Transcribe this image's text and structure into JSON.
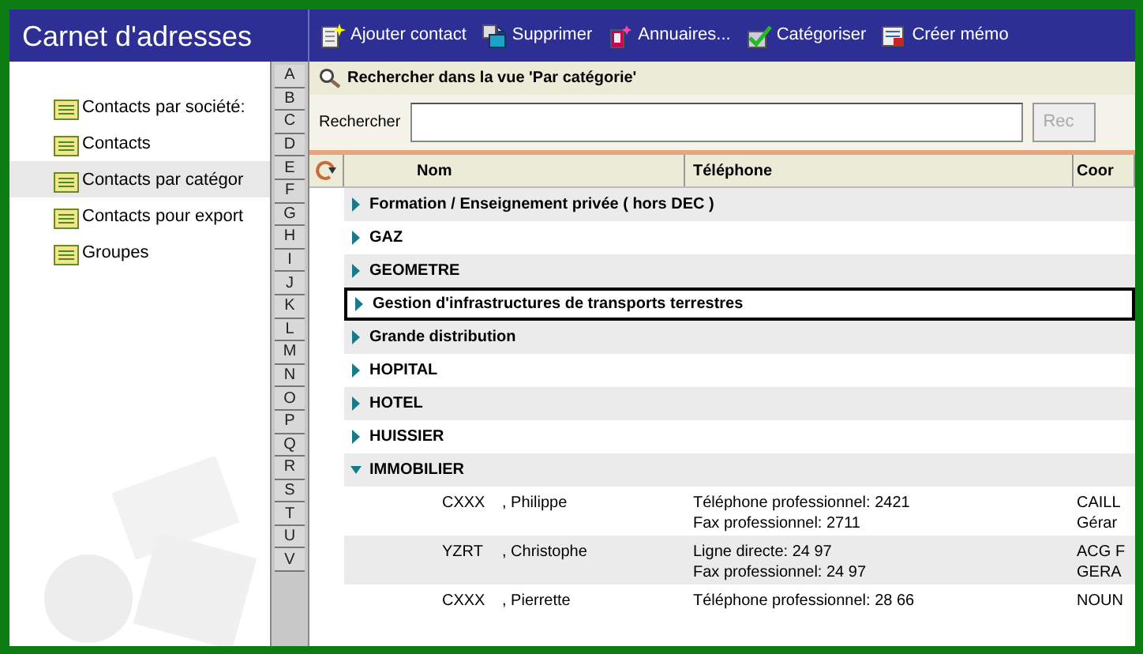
{
  "sidebar": {
    "title": "Carnet d'adresses",
    "items": [
      {
        "label": "Contacts par société:",
        "selected": false
      },
      {
        "label": "Contacts",
        "selected": false
      },
      {
        "label": "Contacts par catégor",
        "selected": true
      },
      {
        "label": "Contacts pour export",
        "selected": false
      },
      {
        "label": "Groupes",
        "selected": false
      }
    ]
  },
  "letters": [
    "A",
    "B",
    "C",
    "D",
    "E",
    "F",
    "G",
    "H",
    "I",
    "J",
    "K",
    "L",
    "M",
    "N",
    "O",
    "P",
    "Q",
    "R",
    "S",
    "T",
    "U",
    "V"
  ],
  "toolbar": [
    {
      "kind": "add",
      "label": "Ajouter contact"
    },
    {
      "kind": "delete",
      "label": "Supprimer"
    },
    {
      "kind": "directory",
      "label": "Annuaires..."
    },
    {
      "kind": "categorize",
      "label": "Catégoriser"
    },
    {
      "kind": "memo",
      "label": "Créer mémo"
    }
  ],
  "search": {
    "title": "Rechercher dans la vue 'Par catégorie'",
    "label": "Rechercher",
    "button": "Rec"
  },
  "table": {
    "columns": [
      "Nom",
      "Téléphone",
      "Coor"
    ],
    "groups": [
      {
        "label": "Formation / Enseignement privée ( hors DEC )",
        "expanded": false,
        "selected": false
      },
      {
        "label": "GAZ",
        "expanded": false,
        "selected": false
      },
      {
        "label": "GEOMETRE",
        "expanded": false,
        "selected": false
      },
      {
        "label": "Gestion d'infrastructures de transports terrestres",
        "expanded": false,
        "selected": true
      },
      {
        "label": "Grande distribution",
        "expanded": false,
        "selected": false
      },
      {
        "label": "HOPITAL",
        "expanded": false,
        "selected": false
      },
      {
        "label": "HOTEL",
        "expanded": false,
        "selected": false
      },
      {
        "label": "HUISSIER",
        "expanded": false,
        "selected": false
      },
      {
        "label": "IMMOBILIER",
        "expanded": true,
        "selected": false,
        "children": [
          {
            "last": "CXXX",
            "first": ", Philippe",
            "phone": [
              "Téléphone professionnel: 2421",
              "Fax professionnel: 2711"
            ],
            "coord": [
              "CAILL",
              "Gérar"
            ]
          },
          {
            "last": "YZRT",
            "first": ", Christophe",
            "phone": [
              "Ligne directe: 24 97",
              "Fax professionnel: 24 97"
            ],
            "coord": [
              "ACG F",
              "GERA"
            ]
          },
          {
            "last": "CXXX",
            "first": ", Pierrette",
            "phone": [
              "Téléphone professionnel: 28 66"
            ],
            "coord": [
              "NOUN"
            ]
          }
        ]
      }
    ]
  }
}
